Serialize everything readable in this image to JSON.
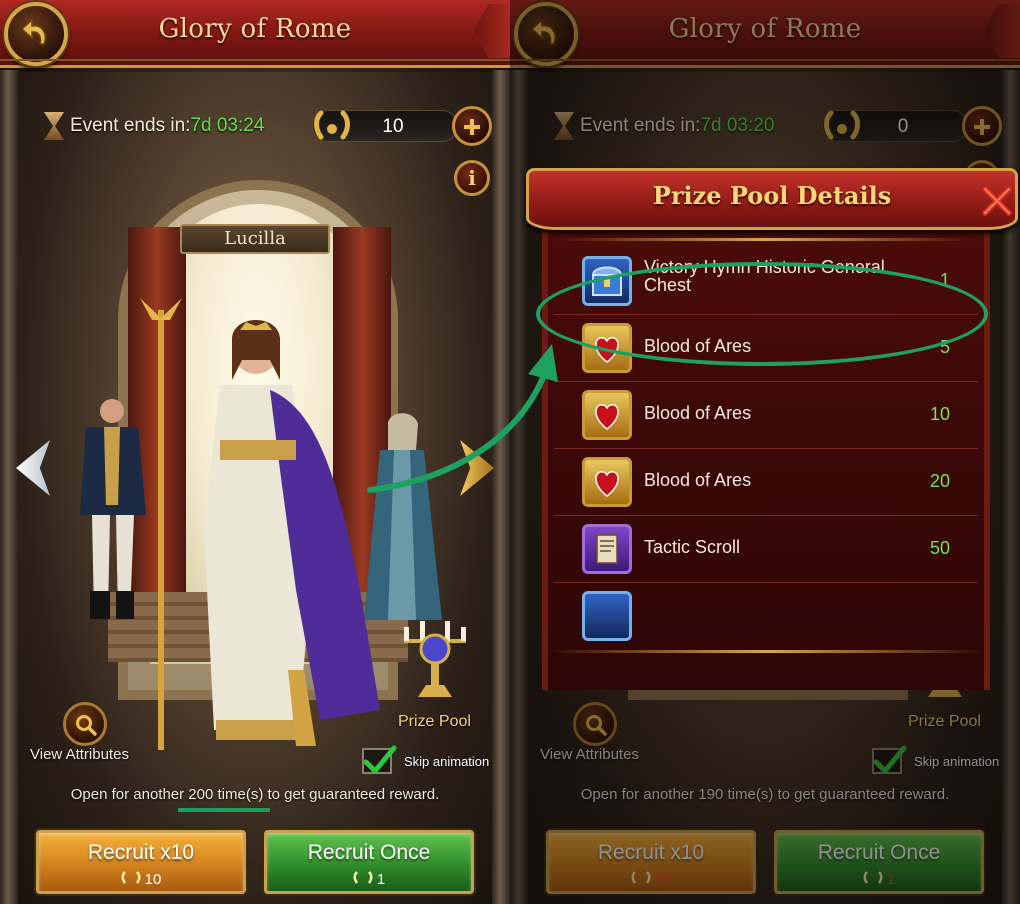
{
  "left": {
    "title": "Glory of Rome",
    "event_label": "Event ends in:",
    "event_time": "7d 03:24",
    "token_count": "10",
    "hero_name": "Lucilla",
    "view_attributes": "View Attributes",
    "prize_pool": "Prize Pool",
    "skip_animation": "Skip animation",
    "skip_checked": true,
    "guarantee_text": "Open for another 200 time(s) to get guaranteed reward.",
    "recruit_x10": {
      "label": "Recruit x10",
      "cost": "10"
    },
    "recruit_once": {
      "label": "Recruit Once",
      "cost": "1"
    }
  },
  "right": {
    "title": "Glory of Rome",
    "event_label": "Event ends in:",
    "event_time": "7d 03:20",
    "token_count": "0",
    "view_attributes": "View Attributes",
    "prize_pool": "Prize Pool",
    "skip_animation": "Skip animation",
    "guarantee_text": "Open for another 190 time(s) to get guaranteed reward.",
    "recruit_x10": {
      "label": "Recruit x10",
      "cost": "10"
    },
    "recruit_once": {
      "label": "Recruit Once",
      "cost": "1"
    },
    "dialog": {
      "title": "Prize Pool Details",
      "items": [
        {
          "name": "Victory Hymn Historic General Chest",
          "qty": "1",
          "icon": "chest-icon"
        },
        {
          "name": "Blood of Ares",
          "qty": "5",
          "icon": "blood-of-ares-icon"
        },
        {
          "name": "Blood of Ares",
          "qty": "10",
          "icon": "blood-of-ares-icon"
        },
        {
          "name": "Blood of Ares",
          "qty": "20",
          "icon": "blood-of-ares-icon"
        },
        {
          "name": "Tactic Scroll",
          "qty": "50",
          "icon": "scroll-icon"
        }
      ]
    }
  },
  "colors": {
    "header_red": "#861a15",
    "gold": "#c99a3e",
    "timer_green": "#62e04a",
    "qty_green": "#7ee04a",
    "annotation_green": "#1ea061",
    "cost_red": "#ff3c2c"
  }
}
